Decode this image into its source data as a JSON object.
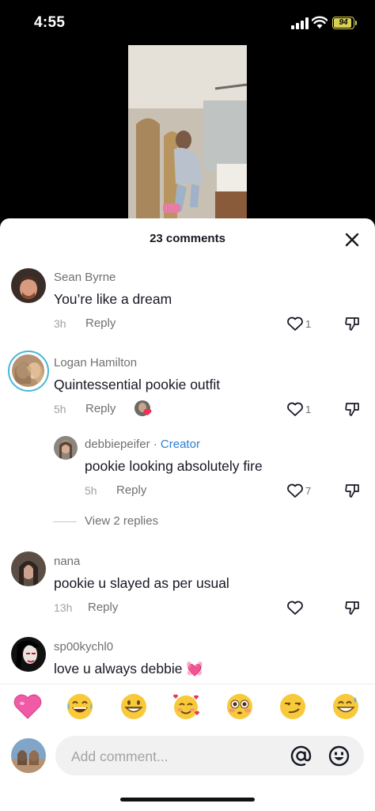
{
  "status_bar": {
    "time": "4:55",
    "battery": "94"
  },
  "sheet": {
    "title": "23 comments"
  },
  "comments": [
    {
      "username": "Sean Byrne",
      "text": "You’re like a dream",
      "time": "3h",
      "reply": "Reply",
      "likes": "1"
    },
    {
      "username": "Logan Hamilton",
      "text": "Quintessential pookie outfit",
      "time": "5h",
      "reply": "Reply",
      "likes": "1"
    },
    {
      "username": "debbiepeifer",
      "badge_sep": " · ",
      "badge": "Creator",
      "text": "pookie looking absolutely fire",
      "time": "5h",
      "reply": "Reply",
      "likes": "7"
    },
    {
      "username": "nana",
      "text": "pookie u slayed as per usual",
      "time": "13h",
      "reply": "Reply",
      "likes": ""
    },
    {
      "username": "sp00kychl0",
      "text": "love u always debbie",
      "text_emoji": "💓"
    }
  ],
  "view_replies": "View 2 replies",
  "quick_emojis": [
    "pink-heart",
    "joy",
    "grin",
    "smiling-face-with-hearts",
    "flushed",
    "smirk",
    "sweat-smile"
  ],
  "input": {
    "placeholder": "Add comment...",
    "value": ""
  },
  "colors": {
    "accent_link": "#2a7fd3",
    "text": "#161823",
    "muted": "#707070",
    "battery": "#d8cf55"
  }
}
